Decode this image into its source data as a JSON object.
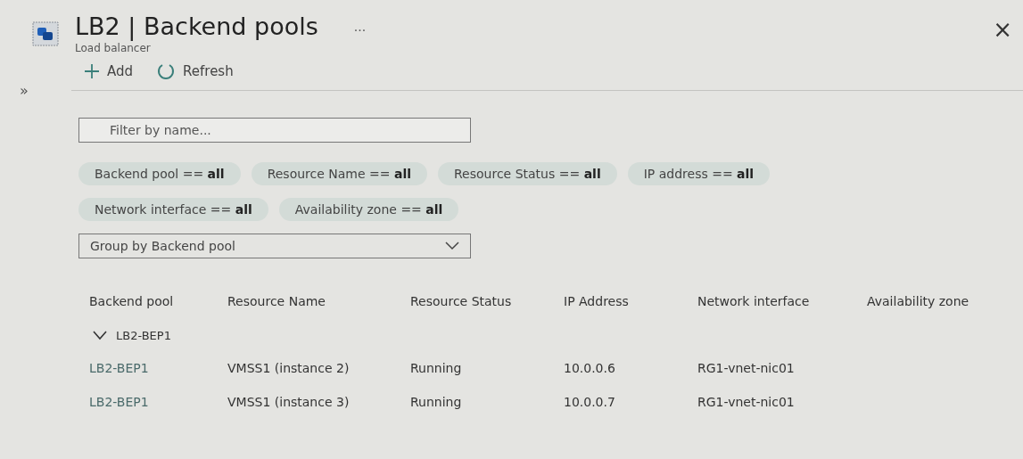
{
  "header": {
    "title": "LB2 | Backend pools",
    "more": "···",
    "subtitle": "Load balancer",
    "close": "×"
  },
  "rail": {
    "expand": "»"
  },
  "toolbar": [
    {
      "kind": "add",
      "label": "Add"
    },
    {
      "kind": "refresh",
      "label": "Refresh"
    }
  ],
  "filter": {
    "placeholder": "Filter by name..."
  },
  "filter_pills": [
    "Backend pool == **all**",
    "Resource Name == **all**",
    "Resource Status == **all**",
    "IP address == **all**",
    "Network interface == **all**",
    "Availability zone == **all**"
  ],
  "group_by": {
    "value": "Group by Backend pool"
  },
  "table": {
    "columns": [
      "Backend pool",
      "Resource Name",
      "Resource Status",
      "IP Address",
      "Network interface",
      "Availability zone"
    ],
    "groups": [
      {
        "name": "LB2-BEP1",
        "expanded": true,
        "rows": [
          [
            "LB2-BEP1",
            "VMSS1 (instance 2)",
            "Running",
            "10.0.0.6",
            "RG1-vnet-nic01"
          ],
          [
            "LB2-BEP1",
            "VMSS1 (instance 3)",
            "Running",
            "10.0.0.7",
            "RG1-vnet-nic01"
          ]
        ]
      }
    ]
  }
}
